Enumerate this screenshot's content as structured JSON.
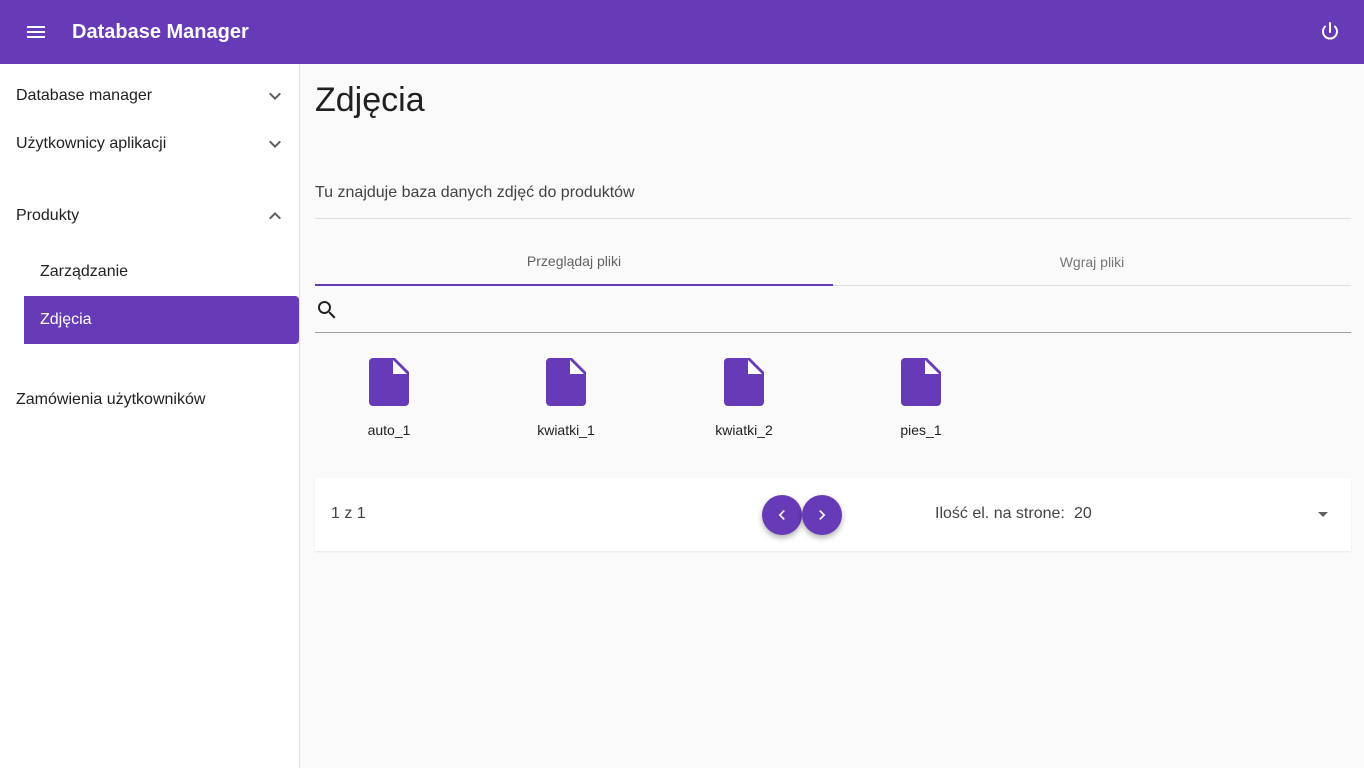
{
  "app": {
    "title": "Database Manager"
  },
  "colors": {
    "primary": "#673ab7"
  },
  "icons": {
    "menu": "menu-icon",
    "power": "power-icon",
    "search": "search-icon",
    "file": "file-icon"
  },
  "sidebar": {
    "items": [
      {
        "label": "Database manager",
        "expanded": false
      },
      {
        "label": "Użytkownicy aplikacji",
        "expanded": false
      },
      {
        "label": "Produkty",
        "expanded": true,
        "children": [
          {
            "label": "Zarządzanie",
            "active": false
          },
          {
            "label": "Zdjęcia",
            "active": true
          }
        ]
      },
      {
        "label": "Zamówienia użytkowników"
      }
    ]
  },
  "main": {
    "title": "Zdjęcia",
    "description": "Tu znajduje baza danych zdjęć do produktów",
    "tabs": [
      {
        "label": "Przeglądaj pliki",
        "active": true
      },
      {
        "label": "Wgraj pliki",
        "active": false
      }
    ],
    "search": {
      "value": "",
      "placeholder": ""
    },
    "files": [
      {
        "name": "auto_1"
      },
      {
        "name": "kwiatki_1"
      },
      {
        "name": "kwiatki_2"
      },
      {
        "name": "pies_1"
      }
    ],
    "pagination": {
      "page_info": "1 z 1",
      "per_page_label": "Ilość el. na strone:",
      "per_page_value": "20"
    }
  }
}
